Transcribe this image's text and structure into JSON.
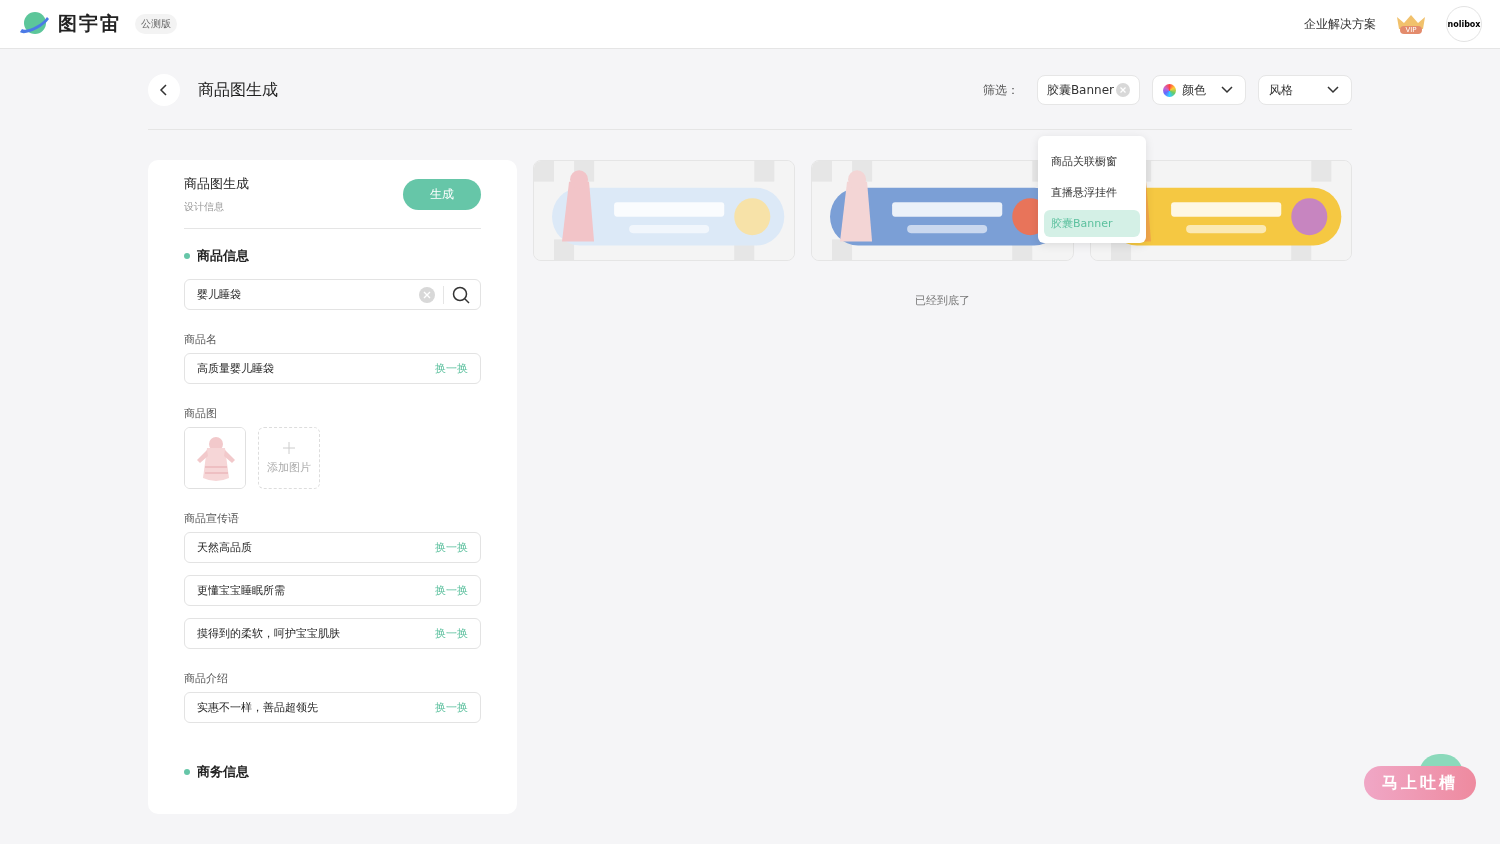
{
  "header": {
    "logo": "图宇宙",
    "badge": "公测版",
    "link": "企业解决方案",
    "vip": "VIP",
    "avatar": "nolibox"
  },
  "page": {
    "title": "商品图生成"
  },
  "filters": {
    "label": "筛选：",
    "chips": [
      {
        "label": "胶囊Banner",
        "kind": "clearable"
      },
      {
        "label": "颜色",
        "kind": "color"
      },
      {
        "label": "风格",
        "kind": "select"
      }
    ]
  },
  "dropdown": {
    "items": [
      {
        "label": "商品关联橱窗",
        "selected": false
      },
      {
        "label": "直播悬浮挂件",
        "selected": false
      },
      {
        "label": "胶囊Banner",
        "selected": true
      }
    ]
  },
  "panel": {
    "title": "商品图生成",
    "subtitle": "设计信息",
    "button": "生成",
    "product_info": {
      "heading": "商品信息",
      "search_value": "婴儿睡袋",
      "groups": [
        {
          "kind": "text",
          "label": "商品名",
          "entries": [
            {
              "value": "高质量婴儿睡袋",
              "action": "换一换"
            }
          ]
        },
        {
          "kind": "images",
          "label": "商品图",
          "add_label": "添加图片"
        },
        {
          "kind": "text",
          "label": "商品宣传语",
          "entries": [
            {
              "value": "天然高品质",
              "action": "换一换"
            },
            {
              "value": "更懂宝宝睡眠所需",
              "action": "换一换"
            },
            {
              "value": "摸得到的柔软，呵护宝宝肌肤",
              "action": "换一换"
            }
          ]
        },
        {
          "kind": "text",
          "label": "商品介绍",
          "entries": [
            {
              "value": "实惠不一样，善品超领先",
              "action": "换一换"
            }
          ]
        }
      ]
    },
    "business_info": {
      "heading": "商务信息"
    }
  },
  "results": {
    "end_text": "已经到底了"
  },
  "feedback_button": "马上吐槽"
}
